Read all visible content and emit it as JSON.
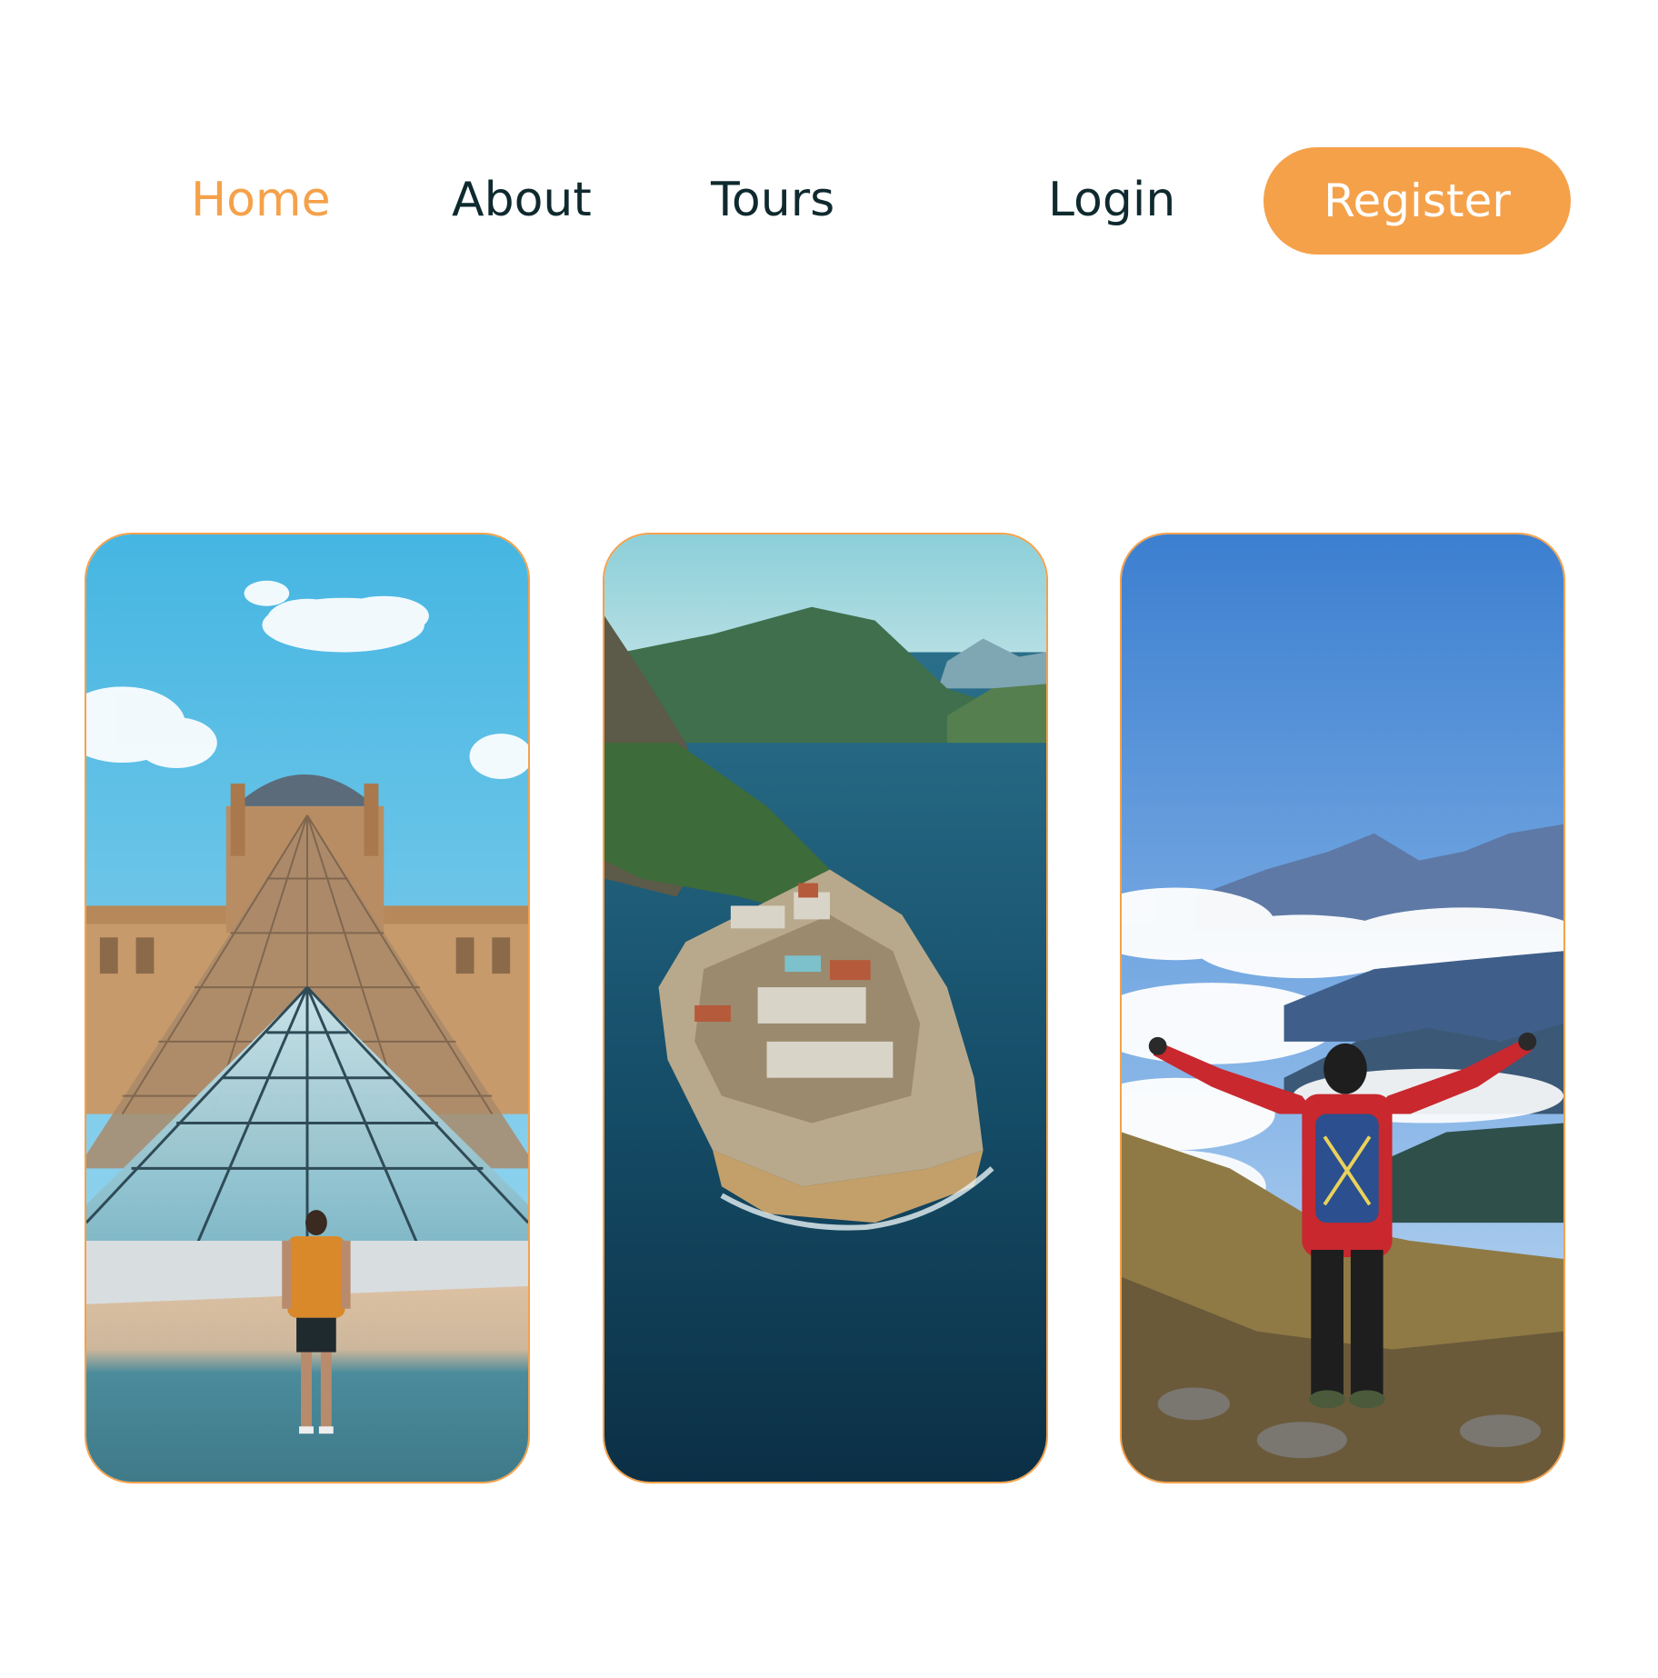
{
  "nav": {
    "items": [
      {
        "label": "Home",
        "active": true
      },
      {
        "label": "About",
        "active": false
      },
      {
        "label": "Tours",
        "active": false
      },
      {
        "label": "Login",
        "active": false
      }
    ],
    "register_label": "Register"
  },
  "colors": {
    "accent": "#f5a14a",
    "text": "#0f2a2e",
    "background": "#ffffff"
  },
  "cards": [
    {
      "image": "louvre-pyramid-traveler-photo"
    },
    {
      "image": "island-fortress-aerial-photo"
    },
    {
      "image": "mountain-hiker-above-clouds-photo"
    }
  ]
}
